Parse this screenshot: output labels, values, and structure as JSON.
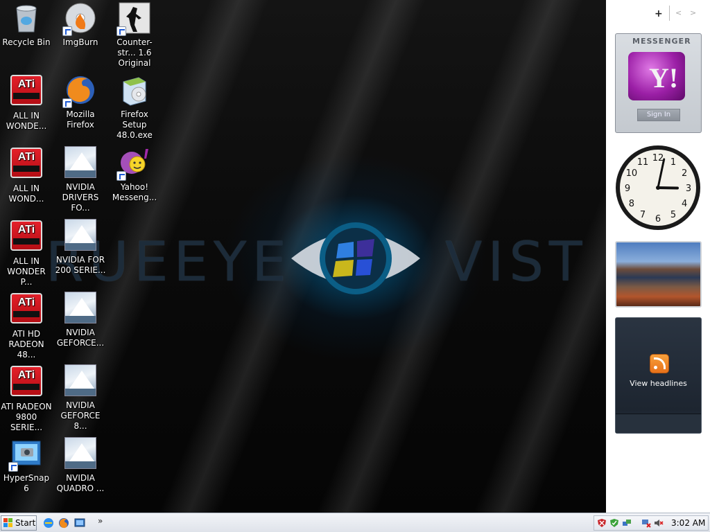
{
  "desktop": {
    "wallpaper_text_left": "RUEEYE",
    "wallpaper_text_right": "VIST",
    "icons": [
      {
        "label": "Recycle Bin"
      },
      {
        "label": "ImgBurn"
      },
      {
        "label": "Counter-str... 1.6 Original"
      },
      {
        "label": "ALL IN WONDE..."
      },
      {
        "label": "Mozilla Firefox"
      },
      {
        "label": "Firefox Setup 48.0.exe"
      },
      {
        "label": "ALL IN WOND..."
      },
      {
        "label": "NVIDIA DRIVERS FO..."
      },
      {
        "label": "Yahoo! Messeng..."
      },
      {
        "label": "ALL IN WONDER P..."
      },
      {
        "label": "NVIDIA FOR 200 SERIE..."
      },
      {
        "label": "ATI HD RADEON 48..."
      },
      {
        "label": "NVIDIA GEFORCE..."
      },
      {
        "label": "ATI RADEON 9800 SERIE..."
      },
      {
        "label": "NVIDIA GEFORCE 8..."
      },
      {
        "label": "HyperSnap 6"
      },
      {
        "label": "NVIDIA QUADRO ..."
      }
    ],
    "ati_logo_text": "ATi"
  },
  "sidebar": {
    "add_label": "+",
    "prev_label": "<",
    "next_label": ">",
    "messenger": {
      "title": "MESSENGER",
      "logo_text": "Y!",
      "signin_label": "Sign In"
    },
    "clock": {
      "hour": 3,
      "minute": 2
    },
    "feeds": {
      "label": "View headlines"
    }
  },
  "taskbar": {
    "start_label": "Start",
    "chevron": "»",
    "time": "3:02 AM"
  },
  "colors": {
    "accent_blue": "#1e5bd6",
    "ati_red": "#d2141d",
    "yahoo_purple": "#9b1fa6",
    "rss_orange": "#f08a24"
  }
}
